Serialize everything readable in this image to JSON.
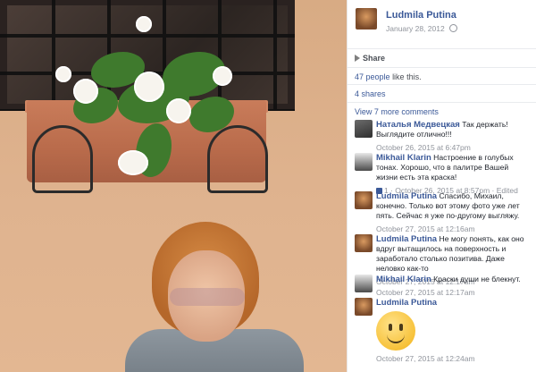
{
  "post": {
    "author": "Ludmila Putina",
    "date": "January 28, 2012",
    "privacy_icon": "globe-icon"
  },
  "actions": {
    "share_label": "Share",
    "share_icon": "share-arrow-icon"
  },
  "stats": {
    "likes_count": "47 people",
    "likes_suffix": "like this.",
    "shares": "4 shares"
  },
  "comments_header": {
    "view_more": "View 7 more comments"
  },
  "comments": [
    {
      "author": "Наталья Медвецкая",
      "text": "Так держать! Выглядите отлично!!!",
      "time": "October 26, 2015 at 6:47pm",
      "avatar": "natalya"
    },
    {
      "author": "Mikhail Klarin",
      "text": "Настроение в голубых тонах. Хорошо, что в палитре Вашей жизни есть эта краска!",
      "likes": "1",
      "time": "October 26, 2015 at 8:57pm",
      "edited": "Edited",
      "avatar": "mikhail"
    },
    {
      "author": "Ludmila Putina",
      "text": "Спасибо, Михаил, конечно. Только вот этому фото уже лет пять. Сейчас я уже по-другому выгляжу.",
      "time": "October 27, 2015 at 12:16am",
      "avatar": "ludmila"
    },
    {
      "author": "Ludmila Putina",
      "text": "Не могу понять, как оно вдруг вытащилось на поверхность и заработало столько позитива. Даже неловко как-то",
      "time": "October 27, 2015 at 12:17am",
      "avatar": "ludmila"
    },
    {
      "author": "Mikhail Klarin",
      "text": "Краски души не блекнут.",
      "time": "October 27, 2015 at 12:17am",
      "avatar": "mikhail"
    },
    {
      "author": "Ludmila Putina",
      "text": "",
      "time": "October 27, 2015 at 12:24am",
      "avatar": "ludmila",
      "sticker": "smiley-sticker"
    }
  ],
  "colors": {
    "link": "#3b5998",
    "meta": "#90949c",
    "text": "#1d2129"
  }
}
